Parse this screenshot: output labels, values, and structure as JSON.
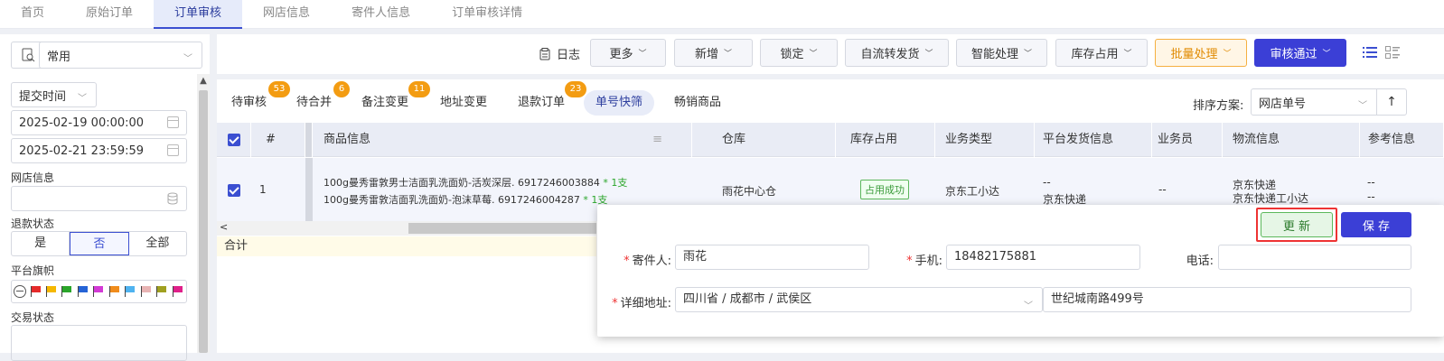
{
  "topnav": {
    "tabs": [
      "首页",
      "原始订单",
      "订单审核",
      "网店信息",
      "寄件人信息",
      "订单审核详情"
    ],
    "active_index": 2
  },
  "left": {
    "scheme": "常用",
    "time_type": "提交时间",
    "date_start": "2025-02-19 00:00:00",
    "date_end": "2025-02-21 23:59:59",
    "shop_label": "网店信息",
    "refund_label": "退款状态",
    "refund_options": [
      "是",
      "否",
      "全部"
    ],
    "refund_selected": "否",
    "flag_label": "平台旗帜",
    "flag_colors": [
      "#e52b2b",
      "#f5b800",
      "#2aa52a",
      "#2563d6",
      "#d33ad6",
      "#f08c1c",
      "#4fb3f0",
      "#e8b4b4",
      "#a0a020",
      "#e0208a"
    ],
    "trade_label": "交易状态"
  },
  "toolbar": {
    "log": "日志",
    "buttons": [
      "更多",
      "新增",
      "锁定",
      "自流转发货",
      "智能处理",
      "库存占用",
      "批量处理",
      "审核通过"
    ]
  },
  "subtabs": [
    {
      "label": "待审核",
      "badge": "53"
    },
    {
      "label": "待合并",
      "badge": "6"
    },
    {
      "label": "备注变更",
      "badge": "11"
    },
    {
      "label": "地址变更",
      "badge": ""
    },
    {
      "label": "退款订单",
      "badge": "23"
    },
    {
      "label": "单号快筛",
      "badge": ""
    },
    {
      "label": "畅销商品",
      "badge": ""
    }
  ],
  "sort": {
    "label": "排序方案:",
    "value": "网店单号"
  },
  "table": {
    "columns": [
      "#",
      "商品信息",
      "仓库",
      "库存占用",
      "业务类型",
      "平台发货信息",
      "业务员",
      "物流信息",
      "参考信息"
    ],
    "row": {
      "index": "1",
      "item1_name": "100g曼秀雷敦男士洁面乳洗面奶-活炭深层. 6917246003884",
      "item1_qty": "* 1支",
      "item2_name": "100g曼秀雷敦洁面乳洗面奶-泡沫草莓. 6917246004287",
      "item2_qty": "* 1支",
      "warehouse": "雨花中心仓",
      "stock": "占用成功",
      "biz_type": "京东工小达",
      "ship_line1": "--",
      "ship_line2": "京东快递",
      "salesman": "--",
      "logistics1": "京东快递",
      "logistics2": "京东快递工小达",
      "ref1": "--",
      "ref2": "--"
    },
    "total_label": "合计"
  },
  "popup": {
    "update_btn": "更 新",
    "save_btn": "保 存",
    "sender_label": "寄件人:",
    "sender_value": "雨花",
    "mobile_label": "手机:",
    "mobile_value": "18482175881",
    "phone_label": "电话:",
    "phone_value": "",
    "address_label": "详细地址:",
    "region_value": "四川省 / 成都市 / 武侯区",
    "street_value": "世纪城南路499号"
  }
}
